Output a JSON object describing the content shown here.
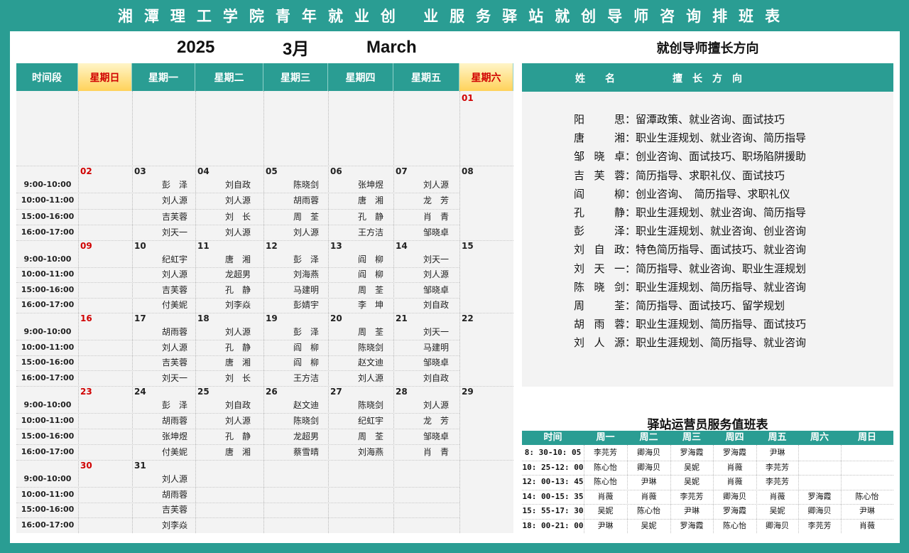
{
  "banner": {
    "title": "湘潭理工学院青年就业创 业服务驿站就创导师咨询排班表"
  },
  "month_header": {
    "year": "2025",
    "month": "3月",
    "month_en": "March"
  },
  "calendar": {
    "headers": [
      "时间段",
      "星期日",
      "星期一",
      "星期二",
      "星期三",
      "星期四",
      "星期五",
      "星期六"
    ],
    "weekend_headers": [
      1,
      7
    ],
    "time_slots": [
      "9:00-10:00",
      "10:00-11:00",
      "15:00-16:00",
      "16:00-17:00"
    ],
    "weeks": [
      {
        "dates": [
          "",
          "",
          "",
          "",
          "",
          "",
          "01"
        ],
        "rows": []
      },
      {
        "dates": [
          "02",
          "03",
          "04",
          "05",
          "06",
          "07",
          "08"
        ],
        "rows": [
          [
            "",
            "彭　泽",
            "刘自政",
            "陈晓剑",
            "张坤煜",
            "刘人源",
            ""
          ],
          [
            "",
            "刘人源",
            "刘人源",
            "胡雨蓉",
            "唐　湘",
            "龙　芳",
            ""
          ],
          [
            "",
            "吉芙蓉",
            "刘　长",
            "周　荃",
            "孔　静",
            "肖　青",
            ""
          ],
          [
            "",
            "刘天一",
            "刘人源",
            "刘人源",
            "王方洁",
            "邹晓卓",
            ""
          ]
        ]
      },
      {
        "dates": [
          "09",
          "10",
          "11",
          "12",
          "13",
          "14",
          "15"
        ],
        "rows": [
          [
            "",
            "纪虹宇",
            "唐　湘",
            "彭　泽",
            "阎　柳",
            "刘天一",
            ""
          ],
          [
            "",
            "刘人源",
            "龙超男",
            "刘海燕",
            "阎　柳",
            "刘人源",
            ""
          ],
          [
            "",
            "吉芙蓉",
            "孔　静",
            "马建明",
            "周　荃",
            "邹晓卓",
            ""
          ],
          [
            "",
            "付美妮",
            "刘李焱",
            "彭婧宇",
            "李　坤",
            "刘自政",
            ""
          ]
        ]
      },
      {
        "dates": [
          "16",
          "17",
          "18",
          "19",
          "20",
          "21",
          "22"
        ],
        "rows": [
          [
            "",
            "胡雨蓉",
            "刘人源",
            "彭　泽",
            "周　荃",
            "刘天一",
            ""
          ],
          [
            "",
            "刘人源",
            "孔　静",
            "阎　柳",
            "陈晓剑",
            "马建明",
            ""
          ],
          [
            "",
            "吉芙蓉",
            "唐　湘",
            "阎　柳",
            "赵文迪",
            "邹晓卓",
            ""
          ],
          [
            "",
            "刘天一",
            "刘　长",
            "王方洁",
            "刘人源",
            "刘自政",
            ""
          ]
        ]
      },
      {
        "dates": [
          "23",
          "24",
          "25",
          "26",
          "27",
          "28",
          "29"
        ],
        "rows": [
          [
            "",
            "彭　泽",
            "刘自政",
            "赵文迪",
            "陈晓剑",
            "刘人源",
            ""
          ],
          [
            "",
            "胡雨蓉",
            "刘人源",
            "陈晓剑",
            "纪虹宇",
            "龙　芳",
            ""
          ],
          [
            "",
            "张坤煜",
            "孔　静",
            "龙超男",
            "周　荃",
            "邹晓卓",
            ""
          ],
          [
            "",
            "付美妮",
            "唐　湘",
            "蔡雪晴",
            "刘海燕",
            "肖　青",
            ""
          ]
        ]
      },
      {
        "dates": [
          "30",
          "31",
          "",
          "",
          "",
          "",
          ""
        ],
        "rows": [
          [
            "",
            "刘人源",
            "",
            "",
            "",
            "",
            ""
          ],
          [
            "",
            "胡雨蓉",
            "",
            "",
            "",
            "",
            ""
          ],
          [
            "",
            "吉芙蓉",
            "",
            "",
            "",
            "",
            ""
          ],
          [
            "",
            "刘李焱",
            "",
            "",
            "",
            "",
            ""
          ]
        ]
      }
    ]
  },
  "expertise": {
    "title": "就创导师擅长方向",
    "header_name": "姓　　名",
    "header_dir": "擅　长　方　向",
    "items": [
      {
        "name": "阳　思",
        "dir": "留潭政策、就业咨询、面试技巧"
      },
      {
        "name": "唐　湘",
        "dir": "职业生涯规划、就业咨询、简历指导"
      },
      {
        "name": "邹晓卓",
        "dir": "创业咨询、面试技巧、职场陷阱援助"
      },
      {
        "name": "吉芙蓉",
        "dir": "简历指导、求职礼仪、面试技巧"
      },
      {
        "name": "阎　柳",
        "dir": "创业咨询、　简历指导、求职礼仪"
      },
      {
        "name": "孔　静",
        "dir": "职业生涯规划、就业咨询、简历指导"
      },
      {
        "name": "彭　泽",
        "dir": "职业生涯规划、就业咨询、创业咨询"
      },
      {
        "name": "刘自政",
        "dir": "特色简历指导、面试技巧、就业咨询"
      },
      {
        "name": "刘天一",
        "dir": "简历指导、就业咨询、职业生涯规划"
      },
      {
        "name": "陈晓剑",
        "dir": "职业生涯规划、简历指导、就业咨询"
      },
      {
        "name": "周　荃",
        "dir": "简历指导、面试技巧、留学规划"
      },
      {
        "name": "胡雨蓉",
        "dir": "职业生涯规划、简历指导、面试技巧"
      },
      {
        "name": "刘人源",
        "dir": "职业生涯规划、简历指导、就业咨询"
      }
    ]
  },
  "duty": {
    "title": "驿站运营员服务值班表",
    "headers": [
      "时间",
      "周一",
      "周二",
      "周三",
      "周四",
      "周五",
      "周六",
      "周日"
    ],
    "rows": [
      [
        "8: 30-10: 05",
        "李芫芳",
        "卿海贝",
        "罗海霞",
        "罗海霞",
        "尹琳",
        "",
        ""
      ],
      [
        "10: 25-12: 00",
        "陈心怡",
        "卿海贝",
        "吴妮",
        "肖薇",
        "李芫芳",
        "",
        ""
      ],
      [
        "12: 00-13: 45",
        "陈心怡",
        "尹琳",
        "吴妮",
        "肖薇",
        "李芫芳",
        "",
        ""
      ],
      [
        "14: 00-15: 35",
        "肖薇",
        "肖薇",
        "李芫芳",
        "卿海贝",
        "肖薇",
        "罗海霞",
        "陈心怡"
      ],
      [
        "15: 55-17: 30",
        "吴妮",
        "陈心怡",
        "尹琳",
        "罗海霞",
        "吴妮",
        "卿海贝",
        "尹琳"
      ],
      [
        "18: 00-21: 00",
        "尹琳",
        "吴妮",
        "罗海霞",
        "陈心怡",
        "卿海贝",
        "李芫芳",
        "肖薇"
      ]
    ]
  },
  "colors": {
    "teal": "#2a9d93",
    "red": "#d00000",
    "weekend_gold": "#ffd25a"
  }
}
